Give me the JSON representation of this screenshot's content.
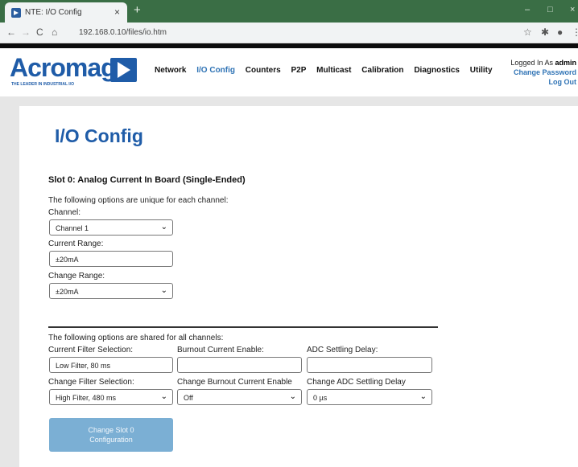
{
  "browser": {
    "tab_title": "NTE: I/O Config",
    "tab_close": "×",
    "new_tab": "+",
    "url": "192.168.0.10/files/io.htm",
    "win_min": "–",
    "win_max": "□",
    "win_close": "×"
  },
  "site": {
    "logo_text": "Acromag",
    "tagline": "THE LEADER IN INDUSTRIAL I/O",
    "nav": {
      "network": "Network",
      "io_config": "I/O Config",
      "counters": "Counters",
      "p2p": "P2P",
      "multicast": "Multicast",
      "calibration": "Calibration",
      "diagnostics": "Diagnostics",
      "utility": "Utility"
    },
    "user": {
      "logged_in_prefix": "Logged In As",
      "username": "admin",
      "change_password": "Change Password",
      "log_out": "Log Out"
    }
  },
  "page": {
    "title": "I/O Config",
    "slot_title": "Slot 0: Analog Current In Board (Single-Ended)",
    "unique_intro": "The following options are unique for each channel:",
    "channel_label": "Channel:",
    "channel_value": "Channel 1",
    "current_range_label": "Current Range:",
    "current_range_value": "±20mA",
    "change_range_label": "Change Range:",
    "change_range_value": "±20mA",
    "shared_intro": "The following options are shared for all channels:",
    "current_filter_label": "Current Filter Selection:",
    "current_filter_value": "Low Filter, 80 ms",
    "burnout_label": "Burnout Current Enable:",
    "burnout_value": "",
    "adc_delay_label": "ADC Settling Delay:",
    "adc_delay_value": "",
    "change_filter_label": "Change Filter Selection:",
    "change_filter_value": "High Filter, 480 ms",
    "change_burnout_label": "Change Burnout Current Enable",
    "change_burnout_value": "Off",
    "change_adc_label": "Change ADC Settling Delay",
    "change_adc_value": "0 µs",
    "submit_line1": "Change Slot 0",
    "submit_line2": "Configuration"
  },
  "colors": {
    "brand_blue": "#1f5ca8",
    "tab_strip": "#3a6e45",
    "button": "#7bafd4"
  }
}
